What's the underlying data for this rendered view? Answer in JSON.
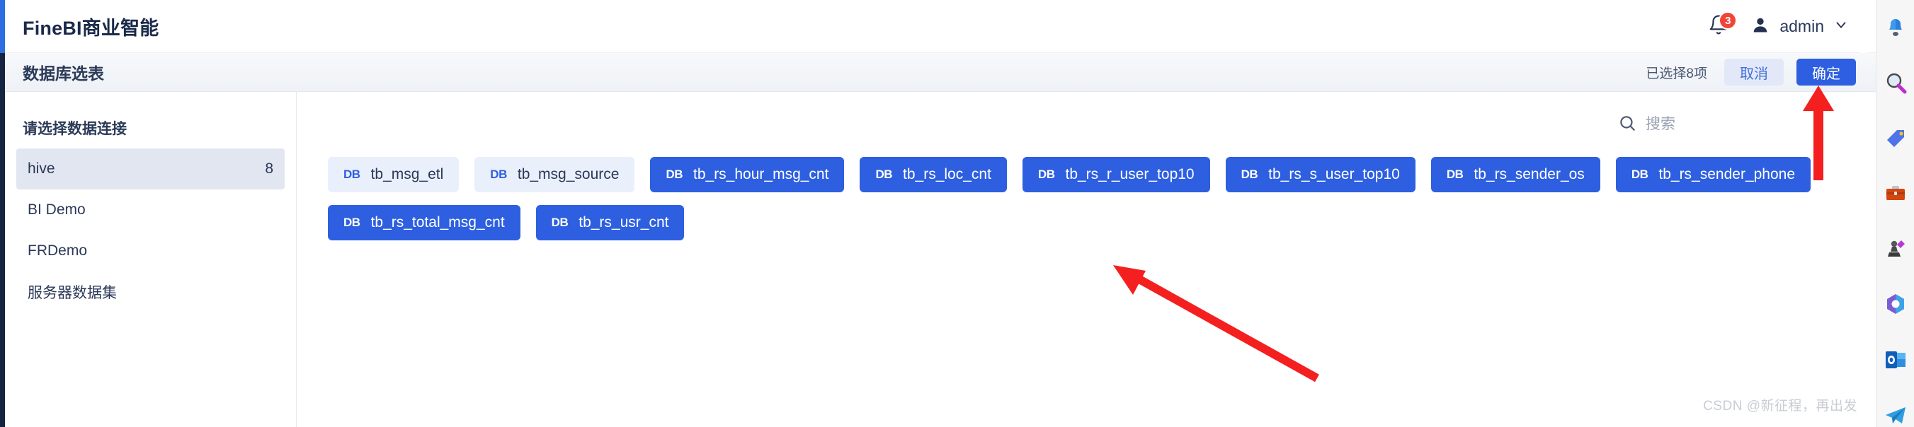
{
  "header": {
    "brand": "FineBI商业智能",
    "notification_badge": "3",
    "user_name": "admin",
    "bell_icon": "bell-icon",
    "user_icon": "user-avatar-icon",
    "chevron_icon": "chevron-down-icon"
  },
  "dialog": {
    "title": "数据库选表",
    "selected_count_label": "已选择8项",
    "cancel_label": "取消",
    "confirm_label": "确定"
  },
  "sidebar": {
    "title": "请选择数据连接",
    "items": [
      {
        "label": "hive",
        "count": "8",
        "active": true
      },
      {
        "label": "BI Demo",
        "count": "",
        "active": false
      },
      {
        "label": "FRDemo",
        "count": "",
        "active": false
      },
      {
        "label": "服务器数据集",
        "count": "",
        "active": false
      }
    ]
  },
  "search": {
    "placeholder": "搜索",
    "value": "",
    "icon": "search-icon"
  },
  "tables": {
    "db_tag": "DB",
    "items": [
      {
        "name": "tb_msg_etl",
        "selected": false
      },
      {
        "name": "tb_msg_source",
        "selected": false
      },
      {
        "name": "tb_rs_hour_msg_cnt",
        "selected": true
      },
      {
        "name": "tb_rs_loc_cnt",
        "selected": true
      },
      {
        "name": "tb_rs_r_user_top10",
        "selected": true
      },
      {
        "name": "tb_rs_s_user_top10",
        "selected": true
      },
      {
        "name": "tb_rs_sender_os",
        "selected": true
      },
      {
        "name": "tb_rs_sender_phone",
        "selected": true
      },
      {
        "name": "tb_rs_total_msg_cnt",
        "selected": true
      },
      {
        "name": "tb_rs_usr_cnt",
        "selected": true
      }
    ]
  },
  "right_strip": {
    "icons": [
      "bell-icon",
      "search-icon",
      "tag-icon",
      "briefcase-icon",
      "chess-pawn-icon",
      "office-icon",
      "outlook-icon",
      "telegram-icon"
    ]
  },
  "annotations": {
    "watermark": "CSDN @新征程，再出发",
    "arrow_confirm": "red-arrow-up-icon",
    "arrow_tables": "red-arrow-upleft-icon"
  },
  "colors": {
    "accent": "#2d5fe0",
    "chip_off_bg": "#eaf0fb",
    "badge_red": "#f0453a",
    "arrow_red": "#f42020",
    "title_text": "#2b3a57"
  }
}
